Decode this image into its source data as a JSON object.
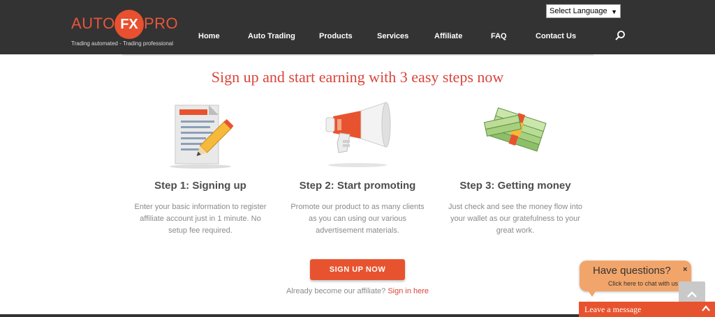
{
  "brand": {
    "logo_left": "AUTO",
    "logo_mid": "FX",
    "logo_right": "PRO",
    "tagline": "Trading automated - Trading professional"
  },
  "language": {
    "selected": "Select Language"
  },
  "nav": {
    "items": [
      {
        "label": "Home"
      },
      {
        "label": "Auto Trading"
      },
      {
        "label": "Products"
      },
      {
        "label": "Services"
      },
      {
        "label": "Affiliate"
      },
      {
        "label": "FAQ"
      },
      {
        "label": "Contact Us"
      }
    ]
  },
  "headline": "Sign up and start earning with 3 easy steps now",
  "steps": [
    {
      "title": "Step 1: Signing up",
      "description": "Enter your basic information to register affiliate account just in 1 minute. No setup fee required.",
      "icon": "document-pencil-icon"
    },
    {
      "title": "Step 2: Start promoting",
      "description": "Promote our product to as many clients as you can using our various advertisement materials.",
      "icon": "megaphone-icon"
    },
    {
      "title": "Step 3: Getting money",
      "description": "Just check and see the money flow into your wallet as our gratefulness to your great work.",
      "icon": "money-stack-icon"
    }
  ],
  "cta": {
    "signup_label": "SIGN UP NOW",
    "already_text": "Already become our affiliate?",
    "signin_label": "Sign in here"
  },
  "chat": {
    "title": "Have questions?",
    "subtitle": "Click here to chat with us",
    "close": "×",
    "leave_message": "Leave a message"
  },
  "colors": {
    "accent": "#e8532f",
    "header_bg": "#333333",
    "headline": "#d9443a"
  }
}
